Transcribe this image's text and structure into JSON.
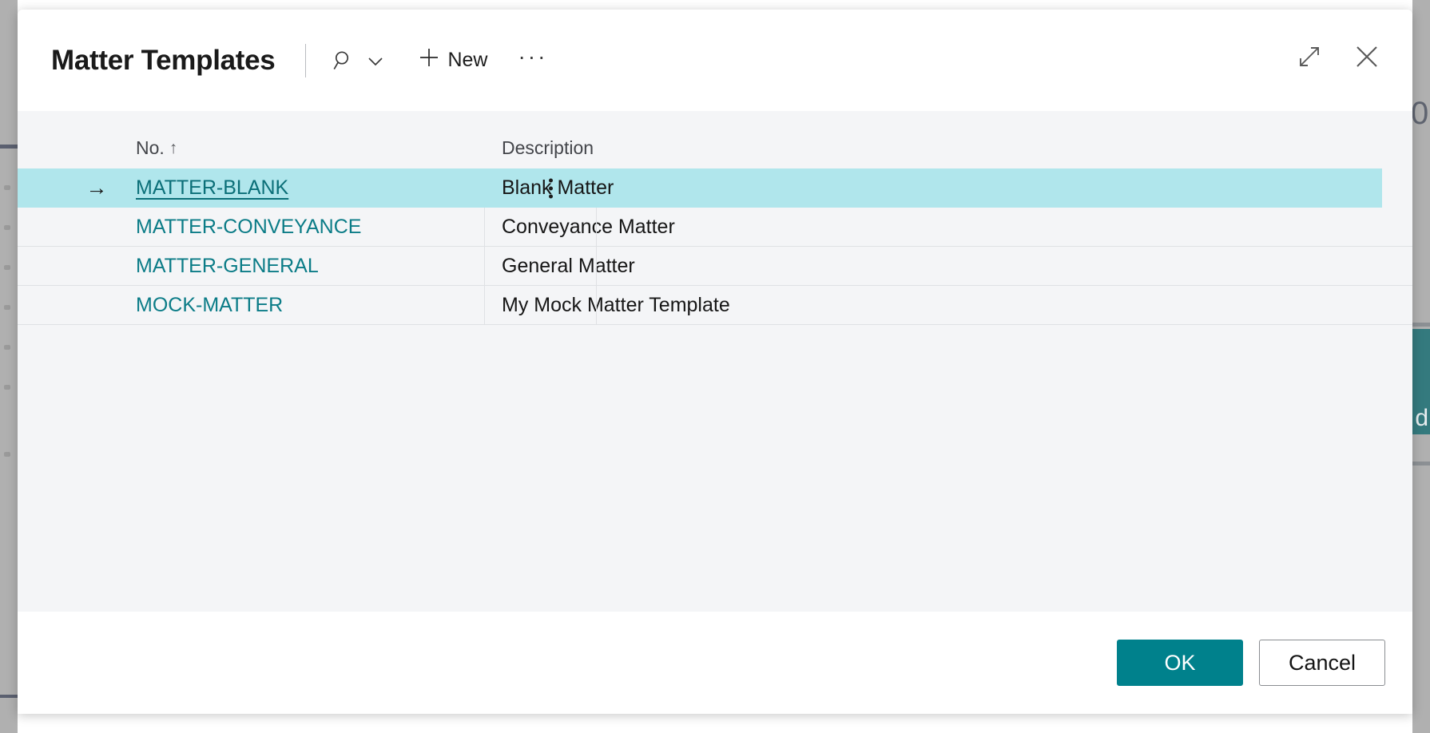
{
  "dialog": {
    "title": "Matter Templates",
    "toolbar": {
      "search_icon": "search-icon",
      "search_chevron_icon": "chevron-down-icon",
      "new_label": "New",
      "new_icon": "plus-icon",
      "overflow_label": "···"
    },
    "window_controls": {
      "expand_icon": "expand-diagonal-icon",
      "close_icon": "close-icon"
    },
    "grid": {
      "columns": [
        {
          "key": "no",
          "label": "No.",
          "sort": "ascending",
          "sort_indicator": "↑"
        },
        {
          "key": "description",
          "label": "Description",
          "sort": "none",
          "sort_indicator": ""
        }
      ],
      "rows": [
        {
          "no": "MATTER-BLANK",
          "description": "Blank Matter",
          "selected": true,
          "indicator": "→",
          "menu_icon": "more-vertical-icon"
        },
        {
          "no": "MATTER-CONVEYANCE",
          "description": "Conveyance Matter",
          "selected": false,
          "indicator": "",
          "menu_icon": ""
        },
        {
          "no": "MATTER-GENERAL",
          "description": "General Matter",
          "selected": false,
          "indicator": "",
          "menu_icon": ""
        },
        {
          "no": "MOCK-MATTER",
          "description": "My Mock Matter Template",
          "selected": false,
          "indicator": "",
          "menu_icon": ""
        }
      ]
    },
    "footer": {
      "ok_label": "OK",
      "cancel_label": "Cancel"
    }
  },
  "background": {
    "right_glyph": "0",
    "right_button_label": "d"
  },
  "colors": {
    "accent_teal": "#00818c",
    "link_teal": "#0b7c87",
    "selected_row": "#b0e6ec",
    "content_bg": "#f4f5f7",
    "dialog_bg": "#ffffff",
    "border_gray": "#dfe1e4"
  }
}
